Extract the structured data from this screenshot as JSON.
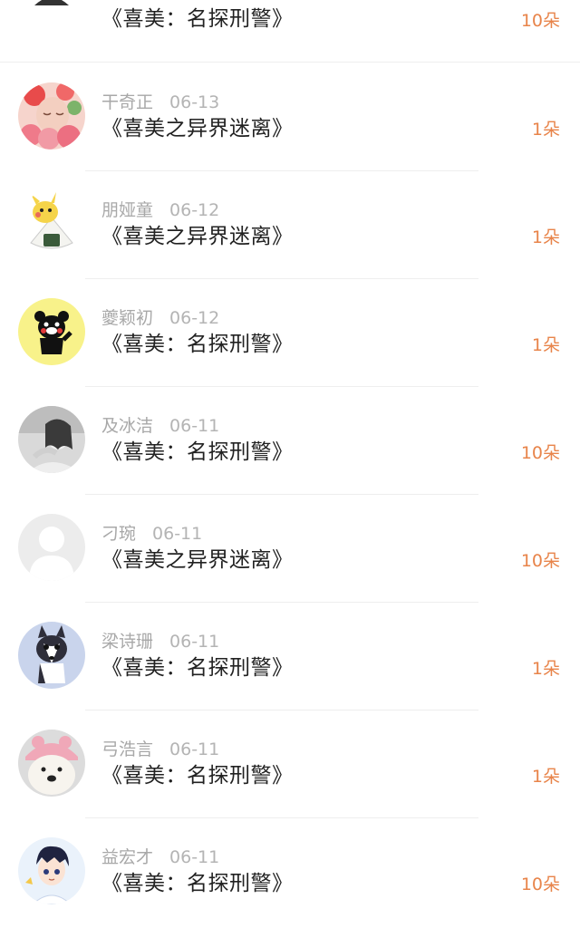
{
  "rows": [
    {
      "name": "",
      "date": "",
      "book": "《喜美：名探刑警》",
      "gift": "10朵",
      "avatar": "cartoon-man-icon"
    },
    {
      "name": "干奇正",
      "date": "06-13",
      "book": "《喜美之异界迷离》",
      "gift": "1朵",
      "avatar": "flower-girl-icon"
    },
    {
      "name": "朋娅童",
      "date": "06-12",
      "book": "《喜美之异界迷离》",
      "gift": "1朵",
      "avatar": "pikachu-riceball-icon"
    },
    {
      "name": "夔颖初",
      "date": "06-12",
      "book": "《喜美：名探刑警》",
      "gift": "1朵",
      "avatar": "kumamon-bear-icon"
    },
    {
      "name": "及冰洁",
      "date": "06-11",
      "book": "《喜美：名探刑警》",
      "gift": "10朵",
      "avatar": "bw-girl-icon"
    },
    {
      "name": "刁琬",
      "date": "06-11",
      "book": "《喜美之异界迷离》",
      "gift": "10朵",
      "avatar": "default-user-icon"
    },
    {
      "name": "梁诗珊",
      "date": "06-11",
      "book": "《喜美：名探刑警》",
      "gift": "1朵",
      "avatar": "husky-dog-icon"
    },
    {
      "name": "弓浩言",
      "date": "06-11",
      "book": "《喜美：名探刑警》",
      "gift": "1朵",
      "avatar": "dog-pink-towel-icon"
    },
    {
      "name": "益宏才",
      "date": "06-11",
      "book": "《喜美：名探刑警》",
      "gift": "10朵",
      "avatar": "anime-boy-icon"
    }
  ]
}
